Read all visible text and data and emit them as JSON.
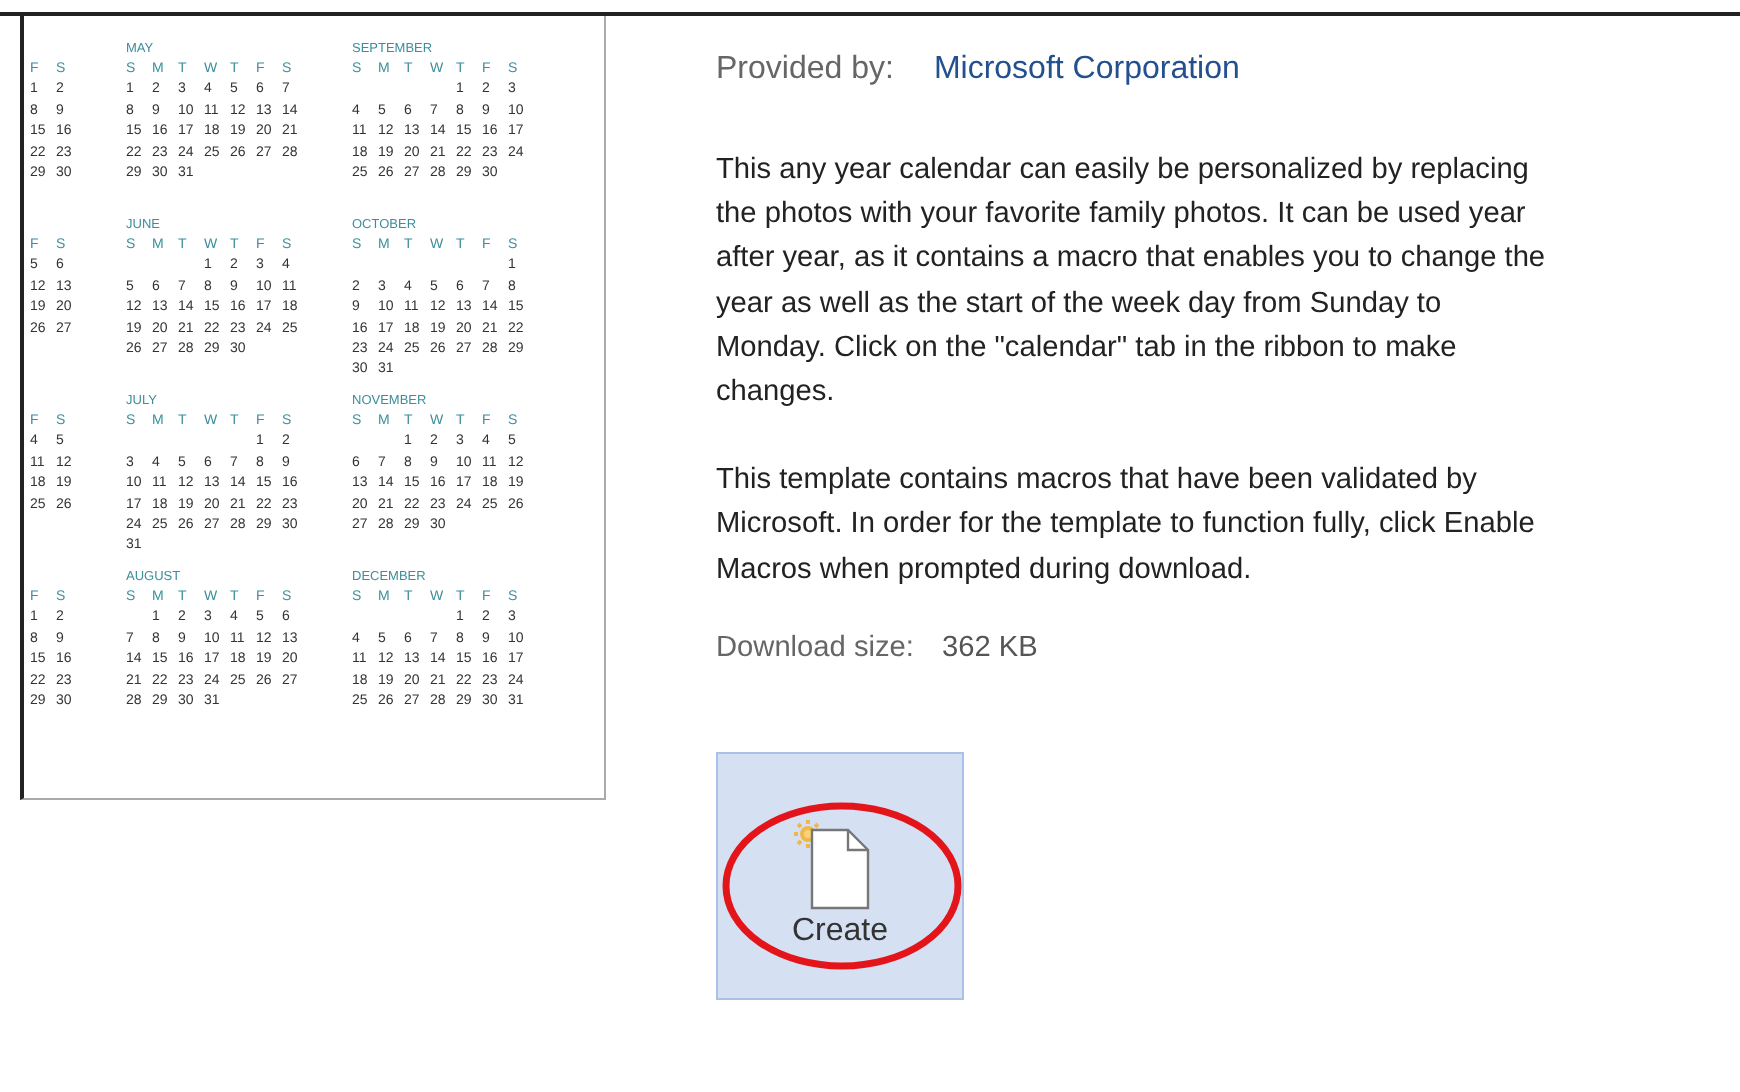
{
  "calendar_months": [
    {
      "weekdays": [
        "F",
        "S"
      ],
      "weeks": [
        [
          "1",
          "2"
        ],
        [
          "8",
          "9"
        ],
        [
          "15",
          "16"
        ],
        [
          "22",
          "23"
        ],
        [
          "29",
          "30"
        ]
      ]
    },
    {
      "name": "MAY",
      "weekdays": [
        "S",
        "M",
        "T",
        "W",
        "T",
        "F",
        "S"
      ],
      "weeks": [
        [
          "1",
          "2",
          "3",
          "4",
          "5",
          "6",
          "7"
        ],
        [
          "8",
          "9",
          "10",
          "11",
          "12",
          "13",
          "14"
        ],
        [
          "15",
          "16",
          "17",
          "18",
          "19",
          "20",
          "21"
        ],
        [
          "22",
          "23",
          "24",
          "25",
          "26",
          "27",
          "28"
        ],
        [
          "29",
          "30",
          "31"
        ]
      ]
    },
    {
      "name": "SEPTEMBER",
      "weekdays": [
        "S",
        "M",
        "T",
        "W",
        "T",
        "F",
        "S"
      ],
      "weeks": [
        [
          "1",
          "2",
          "3"
        ],
        [
          "4",
          "5",
          "6",
          "7",
          "8",
          "9",
          "10"
        ],
        [
          "11",
          "12",
          "13",
          "14",
          "15",
          "16",
          "17"
        ],
        [
          "18",
          "19",
          "20",
          "21",
          "22",
          "23",
          "24"
        ],
        [
          "25",
          "26",
          "27",
          "28",
          "29",
          "30"
        ]
      ]
    },
    {
      "weekdays": [
        "F",
        "S"
      ],
      "weeks": [
        [
          "5",
          "6"
        ],
        [
          "12",
          "13"
        ],
        [
          "19",
          "20"
        ],
        [
          "26",
          "27"
        ]
      ]
    },
    {
      "name": "JUNE",
      "weekdays": [
        "S",
        "M",
        "T",
        "W",
        "T",
        "F",
        "S"
      ],
      "weeks": [
        [
          "1",
          "2",
          "3",
          "4"
        ],
        [
          "5",
          "6",
          "7",
          "8",
          "9",
          "10",
          "11"
        ],
        [
          "12",
          "13",
          "14",
          "15",
          "16",
          "17",
          "18"
        ],
        [
          "19",
          "20",
          "21",
          "22",
          "23",
          "24",
          "25"
        ],
        [
          "26",
          "27",
          "28",
          "29",
          "30"
        ]
      ]
    },
    {
      "name": "OCTOBER",
      "weekdays": [
        "S",
        "M",
        "T",
        "W",
        "T",
        "F",
        "S"
      ],
      "weeks": [
        [
          "1"
        ],
        [
          "2",
          "3",
          "4",
          "5",
          "6",
          "7",
          "8"
        ],
        [
          "9",
          "10",
          "11",
          "12",
          "13",
          "14",
          "15"
        ],
        [
          "16",
          "17",
          "18",
          "19",
          "20",
          "21",
          "22"
        ],
        [
          "23",
          "24",
          "25",
          "26",
          "27",
          "28",
          "29"
        ],
        [
          "30",
          "31"
        ]
      ]
    },
    {
      "weekdays": [
        "F",
        "S"
      ],
      "weeks": [
        [
          "4",
          "5"
        ],
        [
          "11",
          "12"
        ],
        [
          "18",
          "19"
        ],
        [
          "25",
          "26"
        ]
      ]
    },
    {
      "name": "JULY",
      "weekdays": [
        "S",
        "M",
        "T",
        "W",
        "T",
        "F",
        "S"
      ],
      "weeks": [
        [
          "1",
          "2"
        ],
        [
          "3",
          "4",
          "5",
          "6",
          "7",
          "8",
          "9"
        ],
        [
          "10",
          "11",
          "12",
          "13",
          "14",
          "15",
          "16"
        ],
        [
          "17",
          "18",
          "19",
          "20",
          "21",
          "22",
          "23"
        ],
        [
          "24",
          "25",
          "26",
          "27",
          "28",
          "29",
          "30"
        ],
        [
          "31"
        ]
      ]
    },
    {
      "name": "NOVEMBER",
      "weekdays": [
        "S",
        "M",
        "T",
        "W",
        "T",
        "F",
        "S"
      ],
      "weeks": [
        [
          "1",
          "2",
          "3",
          "4",
          "5"
        ],
        [
          "6",
          "7",
          "8",
          "9",
          "10",
          "11",
          "12"
        ],
        [
          "13",
          "14",
          "15",
          "16",
          "17",
          "18",
          "19"
        ],
        [
          "20",
          "21",
          "22",
          "23",
          "24",
          "25",
          "26"
        ],
        [
          "27",
          "28",
          "29",
          "30"
        ]
      ]
    },
    {
      "weekdays": [
        "F",
        "S"
      ],
      "weeks": [
        [
          "1",
          "2"
        ],
        [
          "8",
          "9"
        ],
        [
          "15",
          "16"
        ],
        [
          "22",
          "23"
        ],
        [
          "29",
          "30"
        ]
      ]
    },
    {
      "name": "AUGUST",
      "weekdays": [
        "S",
        "M",
        "T",
        "W",
        "T",
        "F",
        "S"
      ],
      "weeks": [
        [
          "1",
          "2",
          "3",
          "4",
          "5",
          "6"
        ],
        [
          "7",
          "8",
          "9",
          "10",
          "11",
          "12",
          "13"
        ],
        [
          "14",
          "15",
          "16",
          "17",
          "18",
          "19",
          "20"
        ],
        [
          "21",
          "22",
          "23",
          "24",
          "25",
          "26",
          "27"
        ],
        [
          "28",
          "29",
          "30",
          "31"
        ]
      ]
    },
    {
      "name": "DECEMBER",
      "weekdays": [
        "S",
        "M",
        "T",
        "W",
        "T",
        "F",
        "S"
      ],
      "weeks": [
        [
          "1",
          "2",
          "3"
        ],
        [
          "4",
          "5",
          "6",
          "7",
          "8",
          "9",
          "10"
        ],
        [
          "11",
          "12",
          "13",
          "14",
          "15",
          "16",
          "17"
        ],
        [
          "18",
          "19",
          "20",
          "21",
          "22",
          "23",
          "24"
        ],
        [
          "25",
          "26",
          "27",
          "28",
          "29",
          "30",
          "31"
        ]
      ]
    }
  ],
  "details": {
    "provided_by_label": "Provided by:",
    "provider": "Microsoft Corporation",
    "paragraphs": [
      "This any year calendar can easily be personalized by replacing the photos with your favorite family photos. It can be used year after year, as it contains a macro that enables you to change the year as well as the start of the week day from Sunday to Monday. Click on the \"calendar\" tab in the ribbon to make changes.",
      "This template contains macros that have been validated by Microsoft. In order for the template to function fully, click Enable Macros when prompted during download."
    ],
    "download_size_label": "Download size:",
    "download_size": "362 KB"
  },
  "create_button": {
    "label": "Create"
  }
}
